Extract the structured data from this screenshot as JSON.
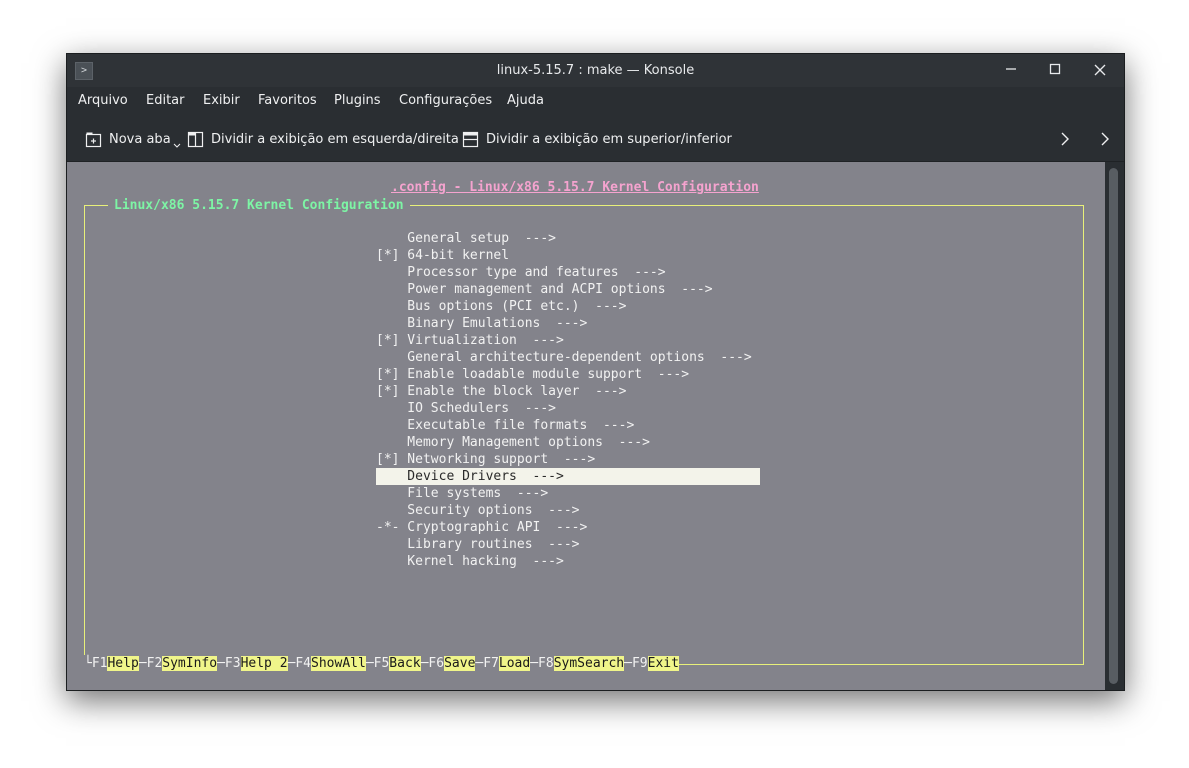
{
  "window": {
    "title": "linux-5.15.7 : make — Konsole",
    "app_icon": "terminal-icon",
    "controls": [
      "minimize-icon",
      "maximize-icon",
      "close-icon"
    ]
  },
  "menubar": {
    "items": [
      "Arquivo",
      "Editar",
      "Exibir",
      "Favoritos",
      "Plugins",
      "Configurações",
      "Ajuda"
    ]
  },
  "toolbar": {
    "new_tab": "Nova aba",
    "split_lr": "Dividir a exibição em esquerda/direita",
    "split_tb": "Dividir a exibição em superior/inferior",
    "chevron": "›"
  },
  "terminal": {
    "colors": {
      "background": "#83838b",
      "title": "#f5a3cf",
      "box_title": "#7df5a5",
      "border": "#e8f07a",
      "highlight": "#f0f58a"
    },
    "config_title": ".config - Linux/x86 5.15.7 Kernel Configuration",
    "box_title": "Linux/x86 5.15.7 Kernel Configuration",
    "menu": [
      {
        "text": "    General setup  --->",
        "selected": false
      },
      {
        "text": "[*] 64-bit kernel",
        "selected": false
      },
      {
        "text": "    Processor type and features  --->",
        "selected": false
      },
      {
        "text": "    Power management and ACPI options  --->",
        "selected": false
      },
      {
        "text": "    Bus options (PCI etc.)  --->",
        "selected": false
      },
      {
        "text": "    Binary Emulations  --->",
        "selected": false
      },
      {
        "text": "[*] Virtualization  --->",
        "selected": false
      },
      {
        "text": "    General architecture-dependent options  --->",
        "selected": false
      },
      {
        "text": "[*] Enable loadable module support  --->",
        "selected": false
      },
      {
        "text": "[*] Enable the block layer  --->",
        "selected": false
      },
      {
        "text": "    IO Schedulers  --->",
        "selected": false
      },
      {
        "text": "    Executable file formats  --->",
        "selected": false
      },
      {
        "text": "    Memory Management options  --->",
        "selected": false
      },
      {
        "text": "[*] Networking support  --->",
        "selected": false
      },
      {
        "text": "    Device Drivers  --->",
        "selected": true
      },
      {
        "text": "    File systems  --->",
        "selected": false
      },
      {
        "text": "    Security options  --->",
        "selected": false
      },
      {
        "text": "-*- Cryptographic API  --->",
        "selected": false
      },
      {
        "text": "    Library routines  --->",
        "selected": false
      },
      {
        "text": "    Kernel hacking  --->",
        "selected": false
      }
    ],
    "fkeys": [
      {
        "key": "F1",
        "label": "Help"
      },
      {
        "key": "F2",
        "label": "SymInfo"
      },
      {
        "key": "F3",
        "label": "Help 2"
      },
      {
        "key": "F4",
        "label": "ShowAll"
      },
      {
        "key": "F5",
        "label": "Back"
      },
      {
        "key": "F6",
        "label": "Save"
      },
      {
        "key": "F7",
        "label": "Load"
      },
      {
        "key": "F8",
        "label": "SymSearch"
      },
      {
        "key": "F9",
        "label": "Exit"
      }
    ]
  }
}
